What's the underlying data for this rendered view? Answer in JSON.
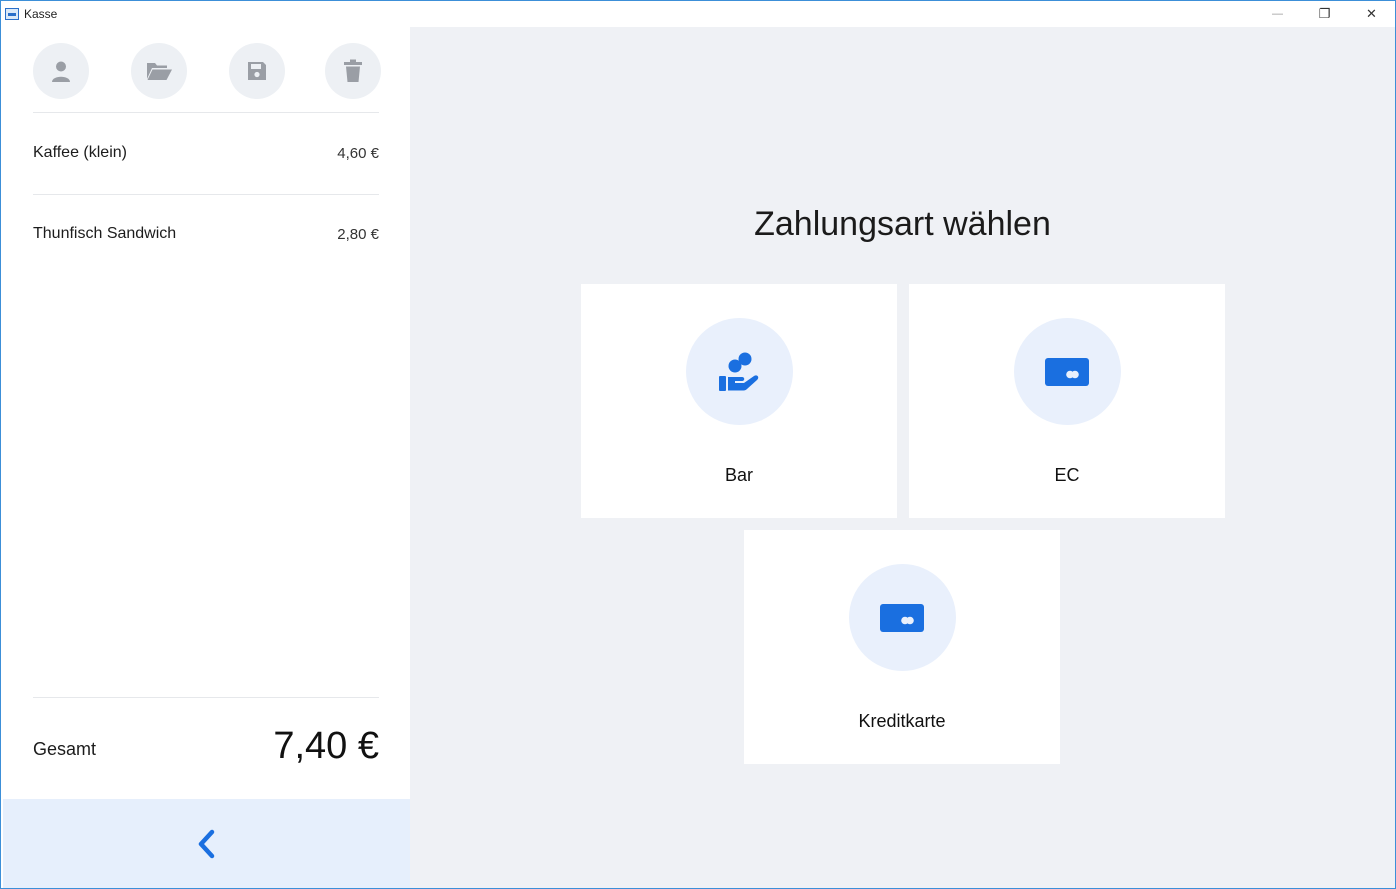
{
  "window": {
    "title": "Kasse",
    "controls": {
      "minimize": "—",
      "restore": "❐",
      "close": "✕"
    }
  },
  "toolbar": {
    "icons": [
      "user-icon",
      "folder-open-icon",
      "save-icon",
      "trash-icon"
    ]
  },
  "cart": {
    "items": [
      {
        "name": "Kaffee (klein)",
        "price": "4,60 €"
      },
      {
        "name": "Thunfisch Sandwich",
        "price": "2,80 €"
      }
    ],
    "total_label": "Gesamt",
    "total_value": "7,40 €"
  },
  "back_button": {
    "icon": "chevron-left-icon"
  },
  "payment": {
    "title": "Zahlungsart wählen",
    "methods": [
      {
        "label": "Bar",
        "icon": "cash-hand-icon"
      },
      {
        "label": "EC",
        "icon": "card-icon"
      },
      {
        "label": "Kreditkarte",
        "icon": "card-icon"
      }
    ]
  },
  "colors": {
    "accent": "#1a6fe0",
    "tool_icon": "#9a9ea5",
    "main_bg": "#eff1f5",
    "icon_circle_bg": "#e9f0fc",
    "back_bar_bg": "#e6effc",
    "window_border": "#3c8fd8"
  }
}
